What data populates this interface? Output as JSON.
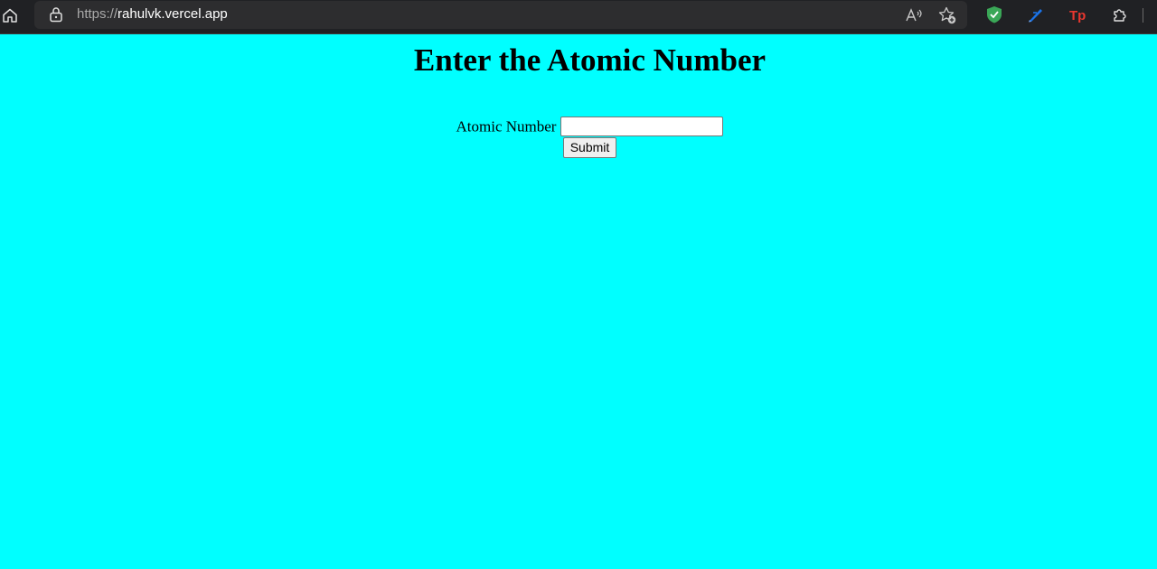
{
  "browser": {
    "url_protocol": "https://",
    "url_host": "rahulvk.vercel.app",
    "icons": [
      "home-icon",
      "lock-icon",
      "read-aloud-icon",
      "add-favorite-icon",
      "shield-extension-icon",
      "pen-extension-icon",
      "tp-extension-icon",
      "extensions-puzzle-icon"
    ],
    "tp_extension_label": "Tp"
  },
  "page": {
    "background_color": "#00ffff",
    "title": "Enter the Atomic Number",
    "form": {
      "label": "Atomic Number",
      "input_value": "",
      "submit_label": "Submit"
    }
  }
}
